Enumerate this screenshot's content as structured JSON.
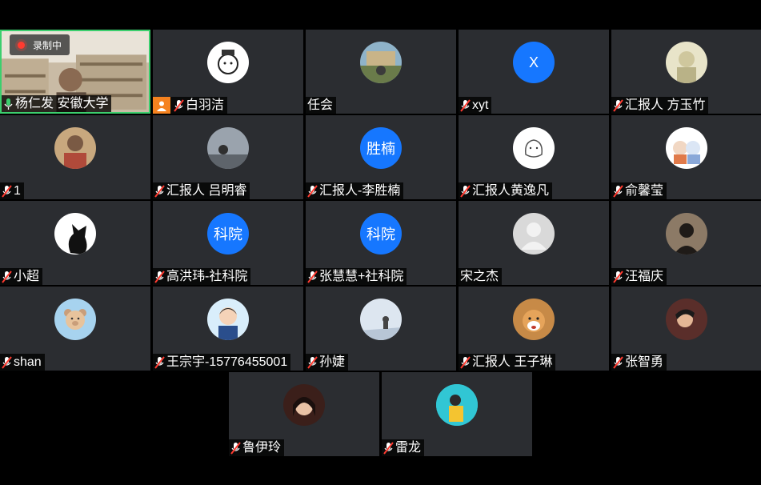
{
  "recording": {
    "label": "录制中"
  },
  "rows": [
    [
      {
        "name": "杨仁发 安徽大学",
        "avatar": "video",
        "active": true,
        "muted": false
      },
      {
        "name": "白羽洁",
        "avatar": "cartoon-icon",
        "host": true,
        "muted": true
      },
      {
        "name": "任会",
        "avatar": "photo-icon",
        "muted": false,
        "nomic": true
      },
      {
        "name": "xyt",
        "avatar": "text",
        "text": "X",
        "muted": true
      },
      {
        "name": "汇报人 方玉竹",
        "avatar": "photo-icon",
        "muted": true
      }
    ],
    [
      {
        "name": "1",
        "avatar": "photo-icon",
        "muted": true
      },
      {
        "name": "汇报人 吕明睿",
        "avatar": "photo-icon",
        "muted": true
      },
      {
        "name": "汇报人-李胜楠",
        "avatar": "text",
        "text": "胜楠",
        "muted": true
      },
      {
        "name": "汇报人黄逸凡",
        "avatar": "sketch-icon",
        "muted": true
      },
      {
        "name": "俞馨莹",
        "avatar": "cartoon-icon",
        "muted": true
      }
    ],
    [
      {
        "name": "小超",
        "avatar": "cat-icon",
        "muted": true
      },
      {
        "name": "高洪玮-社科院",
        "avatar": "text",
        "text": "科院",
        "muted": true
      },
      {
        "name": "张慧慧+社科院",
        "avatar": "text",
        "text": "科院",
        "muted": true
      },
      {
        "name": "宋之杰",
        "avatar": "default-user-icon",
        "muted": false,
        "nomic": true
      },
      {
        "name": "汪福庆",
        "avatar": "photo-icon",
        "muted": true
      }
    ],
    [
      {
        "name": "shan",
        "avatar": "bear-icon",
        "muted": true
      },
      {
        "name": "王宗宇-15776455001",
        "avatar": "cartoon-icon",
        "muted": true
      },
      {
        "name": "孙婕",
        "avatar": "photo-icon",
        "muted": true
      },
      {
        "name": "汇报人 王子琳",
        "avatar": "dog-icon",
        "muted": true
      },
      {
        "name": "张智勇",
        "avatar": "photo-icon",
        "muted": true
      }
    ],
    [
      {
        "name": "鲁伊玲",
        "avatar": "photo-icon",
        "muted": true
      },
      {
        "name": "雷龙",
        "avatar": "cartoon-icon",
        "muted": true
      }
    ]
  ],
  "colors": {
    "tile": "#2b2d31",
    "accent": "#1677ff",
    "active_border": "#3ccf6e",
    "host": "#f5821f"
  }
}
